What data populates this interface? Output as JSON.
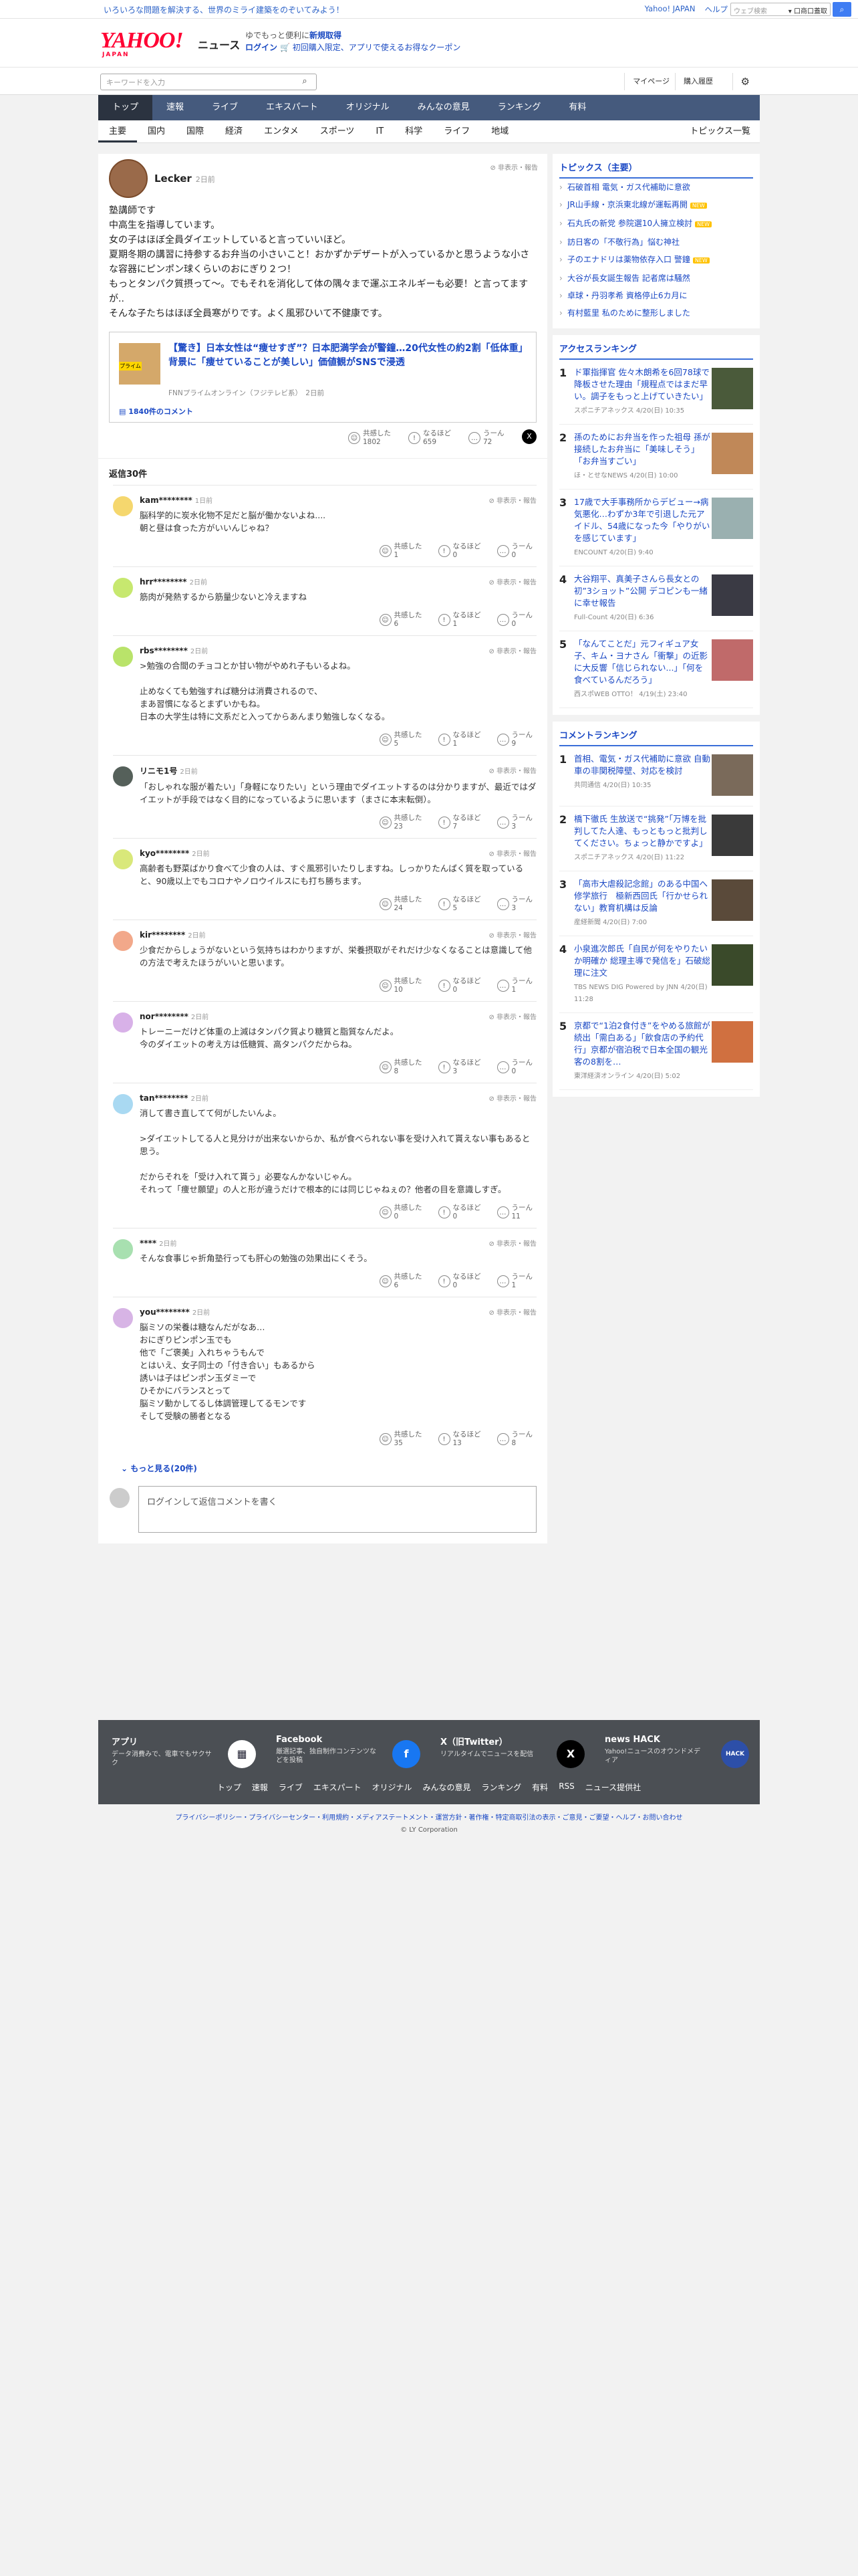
{
  "topbar": {
    "promo": "いろいろな問題を解決する、世界のミライ建築をのぞいてみよう！",
    "links": [
      "Yahoo! JAPAN",
      "ヘルプ"
    ],
    "search_placeholder": "ウェブ検索",
    "search_option": "▾ 口商口蓋取",
    "search_button": "検索"
  },
  "header": {
    "logo": "YAHOO!",
    "logo_sub": "JAPAN",
    "logo_news": "ニュース",
    "msg_line1_prefix": "ゆでもっと便利に",
    "msg_line1_link": "新規取得",
    "msg_line2_link": "ログイン",
    "msg_line2_rest": "🛒 初回購入限定、アプリで使えるお得なクーポン"
  },
  "searchbar": {
    "placeholder": "キーワードを入力",
    "mypage": "マイページ",
    "history": "購入履歴"
  },
  "nav_primary": [
    "トップ",
    "速報",
    "ライブ",
    "エキスパート",
    "オリジナル",
    "みんなの意見",
    "ランキング",
    "有料"
  ],
  "nav_secondary": [
    "主要",
    "国内",
    "国際",
    "経済",
    "エンタメ",
    "スポーツ",
    "IT",
    "科学",
    "ライフ",
    "地域"
  ],
  "nav_secondary_right": "トピックス一覧",
  "comment": {
    "user": "Lecker",
    "time": "2日前",
    "report": "非表示・報告",
    "lines": [
      "塾講師です",
      "中高生を指導しています。",
      "女の子はほぼ全員ダイエットしていると言っていいほど。",
      "夏期冬期の講習に持参するお弁当の小さいこと！おかずかデザートが入っているかと思うような小さな容器にピンポン球くらいのおにぎり２つ！",
      "もっとタンパク質摂って〜。でもそれを消化して体の隅々まで運ぶエネルギーも必要！と言ってますが..",
      "そんな子たちはほぼ全員寒がりです。よく風邪ひいて不健康です。"
    ],
    "card_title": "【驚き】日本女性は“痩せすぎ”？日本肥満学会が警鐘…20代女性の約2割「低体重」背景に「痩せていることが美しい」価値観がSNSで浸透",
    "card_source": "FNNプライムオンライン（フジテレビ系）　2日前",
    "card_badge": "プライム",
    "card_comments": "1840件のコメント",
    "reactions": [
      {
        "label": "共感した",
        "count": "1802",
        "icon": "☺"
      },
      {
        "label": "なるほど",
        "count": "659",
        "icon": "!"
      },
      {
        "label": "うーん",
        "count": "72",
        "icon": "…"
      }
    ],
    "x_icon": "X"
  },
  "replies_header": "返信30件",
  "replies": [
    {
      "user": "kam********",
      "time": "1日前",
      "color": "#f5d76e",
      "text": [
        "脳科学的に炭水化物不足だと脳が働かないよね....",
        "朝と昼は食った方がいいんじゃね？"
      ],
      "r": [
        "1",
        "0",
        "0"
      ]
    },
    {
      "user": "hrr********",
      "time": "2日前",
      "color": "#c7e86f",
      "text": [
        "筋肉が発熱するから筋量少ないと冷えますね"
      ],
      "r": [
        "6",
        "1",
        "0"
      ]
    },
    {
      "user": "rbs********",
      "time": "2日前",
      "color": "#b9e36a",
      "text": [
        ">勉強の合間のチョコとか甘い物がやめれ子もいるよね。",
        "",
        "止めなくても勉強すれば糖分は消費されるので、",
        "まあ習慣になるとまずいかもね。",
        "日本の大学生は特に文系だと入ってからあんまり勉強しなくなる。"
      ],
      "r": [
        "5",
        "1",
        "9"
      ]
    },
    {
      "user": "リニモ1号",
      "time": "2日前",
      "color": "#55605a",
      "text": [
        "「おしゃれな服が着たい」「身軽になりたい」という理由でダイエットするのは分かりますが、最近ではダイエットが手段ではなく目的になっているように思います（まさに本末転倒）。"
      ],
      "r": [
        "23",
        "7",
        "3"
      ]
    },
    {
      "user": "kyo********",
      "time": "2日前",
      "color": "#d9e87a",
      "text": [
        "高齢者も野菜ばかり食べて少食の人は、すぐ風邪引いたりしますね。しっかりたんぱく質を取っていると、90歳以上でもコロナやノロウイルスにも打ち勝ちます。"
      ],
      "r": [
        "24",
        "5",
        "3"
      ]
    },
    {
      "user": "kir********",
      "time": "2日前",
      "color": "#f2a88a",
      "text": [
        "少食だからしょうがないという気持ちはわかりますが、栄養摂取がそれだけ少なくなることは意識して他の方法で考えたほうがいいと思います。"
      ],
      "r": [
        "10",
        "0",
        "1"
      ]
    },
    {
      "user": "nor********",
      "time": "2日前",
      "color": "#d8b1e8",
      "text": [
        "トレーニーだけど体重の上減はタンパク質より糖質と脂質なんだよ。",
        "今のダイエットの考え方は低糖質、高タンパクだからね。"
      ],
      "r": [
        "8",
        "3",
        "0"
      ]
    },
    {
      "user": "tan********",
      "time": "2日前",
      "color": "#a9d9f2",
      "text": [
        "消して書き直してて何がしたいんよ。",
        "",
        ">ダイエットしてる人と見分けが出来ないからか、私が食べられない事を受け入れて貰えない事もあると思う。",
        "",
        "だからそれを「受け入れて貰う」必要なんかないじゃん。",
        "それって「痩せ願望」の人と形が違うだけで根本的には同じじゃねぇの？他者の目を意識しすぎ。"
      ],
      "r": [
        "0",
        "0",
        "11"
      ]
    },
    {
      "user": "****",
      "time": "2日前",
      "color": "#a8e0b0",
      "text": [
        "そんな食事じゃ折角塾行っても肝心の勉強の効果出にくそう。"
      ],
      "r": [
        "6",
        "0",
        "1"
      ]
    },
    {
      "user": "you********",
      "time": "2日前",
      "color": "#d7b4e5",
      "text": [
        "脳ミソの栄養は糖なんだがなあ…",
        "おにぎりピンポン玉でも",
        "他で「ご褒美」入れちゃうもんで",
        "とはいえ、女子同士の「付き合い」もあるから",
        "誘いは子はピンポン玉ダミーで",
        "ひそかにバランスとって",
        "脳ミソ動かしてるし体調管理してるモンです",
        "そして受験の勝者となる"
      ],
      "r": [
        "35",
        "13",
        "8"
      ]
    }
  ],
  "reaction_labels": [
    "共感した",
    "なるほど",
    "うーん"
  ],
  "more_link": "もっと見る(20件)",
  "login_prompt": "ログインして返信コメントを書く",
  "sidebar": {
    "topics_title": "トピックス（主要）",
    "topics": [
      {
        "t": "石破首相 電気・ガス代補助に意欲",
        "new": false
      },
      {
        "t": "JR山手線・京浜東北線が運転再開",
        "new": true
      },
      {
        "t": "石丸氏の新党 参院選10人擁立検討",
        "new": true
      },
      {
        "t": "訪日客の「不敬行為」悩む神社",
        "new": false
      },
      {
        "t": "子のエナドリは薬物依存入口 警鐘",
        "new": true
      },
      {
        "t": "大谷が長女誕生報告 記者席は騒然",
        "new": false
      },
      {
        "t": "卓球・丹羽孝希 資格停止6カ月に",
        "new": false
      },
      {
        "t": "有村藍里 私のために整形しました",
        "new": false
      }
    ],
    "new_label": "NEW",
    "access_title": "アクセスランキング",
    "access": [
      {
        "n": "1",
        "t": "ド軍指揮官 佐々木朗希を6回78球で降板させた理由「規程点ではまだ早い。調子をもっと上げていきたい」",
        "m": "スポニチアネックス 4/20(日) 10:35",
        "c": "#4a5a3a"
      },
      {
        "n": "2",
        "t": "孫のためにお弁当を作った祖母 孫が接続したお弁当に「美味しそう」「お弁当すごい」",
        "m": "ほ・とせなNEWS 4/20(日) 10:00",
        "c": "#c08858"
      },
      {
        "n": "3",
        "t": "17歳で大手事務所からデビュー→病気悪化…わずか3年で引退した元アイドル、54歳になった今「やりがいを感じています」",
        "m": "ENCOUNT 4/20(日) 9:40",
        "c": "#9ab0b0"
      },
      {
        "n": "4",
        "t": "大谷翔平、真美子さんら長女との初”3ショット”公開 デコピンも一緒に幸せ報告",
        "m": "Full-Count 4/20(日) 6:36",
        "c": "#3a3a44"
      },
      {
        "n": "5",
        "t": "「なんてことだ」元フィギュア女子、キム・ヨナさん「衝撃」の近影に大反響「信じられない...」「何を食べているんだろう」",
        "m": "西スポWEB OTTO！ 4/19(土) 23:40",
        "c": "#c06a6a"
      }
    ],
    "comment_title": "コメントランキング",
    "comments": [
      {
        "n": "1",
        "t": "首相、電気・ガス代補助に意欲 自動車の非関税障壁、対応を検討",
        "m": "共同通信 4/20(日) 10:35",
        "c": "#7a6a5a"
      },
      {
        "n": "2",
        "t": "橋下徹氏 生放送で“挑発”「万博を批判してた人達、もっともっと批判してください。ちょっと静かですよ」",
        "m": "スポニチアネックス 4/20(日) 11:22",
        "c": "#3a3a3a"
      },
      {
        "n": "3",
        "t": "「高市大虐殺記念館」のある中国へ修学旅行　極新西回氏「行かせられない」教育机構は反論",
        "m": "産経新聞 4/20(日) 7:00",
        "c": "#5a4a3a"
      },
      {
        "n": "4",
        "t": "小泉進次郎氏「自民が何をやりたいか明確か 総理主導で発信を」石破総理に注文",
        "m": "TBS NEWS DIG Powered by JNN 4/20(日) 11:28",
        "c": "#3a4a2a"
      },
      {
        "n": "5",
        "t": "京都で“1泊2食付き”をやめる旅館が続出「需白ある」「飲食店の予約代行」京都が宿泊税で日本全国の観光客の8割を…",
        "m": "東洋経済オンライン 4/20(日) 5:02",
        "c": "#d07040"
      }
    ]
  },
  "footer": {
    "cards": [
      {
        "t": "アプリ",
        "d": "データ消費みで、電車でもサクサク",
        "i": "▦",
        "c": "#ffffff",
        "tc": "#223"
      },
      {
        "t": "Facebook",
        "d": "厳選記事、独自制作コンテンツなどを投稿",
        "i": "f",
        "c": "#1877f2",
        "tc": "#fff"
      },
      {
        "t": "X（旧Twitter）",
        "d": "リアルタイムでニュースを配信",
        "i": "X",
        "c": "#000",
        "tc": "#fff"
      },
      {
        "t": "news HACK",
        "d": "Yahoo!ニュースのオウンドメディア",
        "i": "HACK",
        "c": "#2d4fa8",
        "tc": "#fff"
      }
    ],
    "links": [
      "トップ",
      "速報",
      "ライブ",
      "エキスパート",
      "オリジナル",
      "みんなの意見",
      "ランキング",
      "有料",
      "RSS",
      "ニュース提供社"
    ],
    "legal": "プライバシーポリシー・プライバシーセンター・利用規約・メディアステートメント・運営方針・著作権・特定商取引法の表示・ご意見・ご要望・ヘルプ・お問い合わせ",
    "copyright": "© LY Corporation"
  }
}
